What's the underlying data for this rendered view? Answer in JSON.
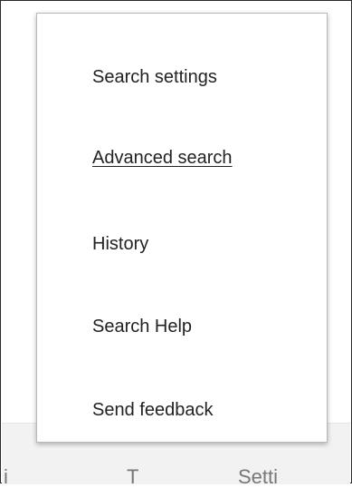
{
  "menu": {
    "items": [
      {
        "label": "Search settings",
        "hovered": false
      },
      {
        "label": "Advanced search",
        "hovered": true
      },
      {
        "label": "History",
        "hovered": false
      },
      {
        "label": "Search Help",
        "hovered": false
      },
      {
        "label": "Send feedback",
        "hovered": false
      }
    ]
  },
  "footer": {
    "items": [
      {
        "label": "i"
      },
      {
        "label": "T"
      },
      {
        "label": "Setti"
      }
    ]
  },
  "colors": {
    "menu_text": "#222222",
    "menu_border": "#b8b8b8",
    "footer_background": "#f2f2f2",
    "footer_text": "#777777"
  }
}
